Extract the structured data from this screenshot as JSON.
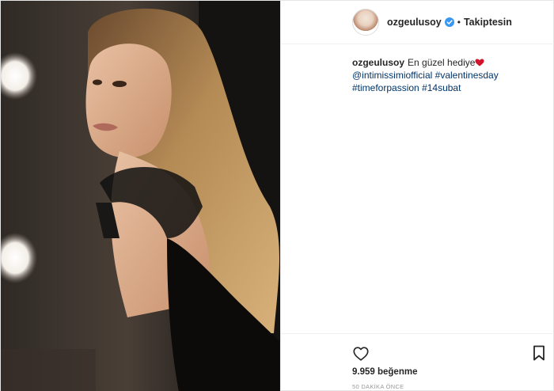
{
  "post": {
    "username": "ozgeulusoy",
    "follow_status": "Takiptesin",
    "separator": "•",
    "caption": {
      "username": "ozgeulusoy",
      "text": "En güzel hediye",
      "mention": "@intimissimiofficial",
      "hashtags": [
        "#valentinesday",
        "#timeforpassion",
        "#14subat"
      ]
    },
    "likes_count": "9.959",
    "likes_label": "beğenme",
    "time_ago": "50 DAKİKA ÖNCE"
  },
  "colors": {
    "link": "#003569",
    "text": "#262626",
    "verified_badge": "#3897f0",
    "muted": "#999999"
  },
  "icons": {
    "like": "heart-outline-icon",
    "save": "bookmark-outline-icon",
    "verified": "verified-badge-icon",
    "caption_emoji": "red-heart-emoji"
  }
}
